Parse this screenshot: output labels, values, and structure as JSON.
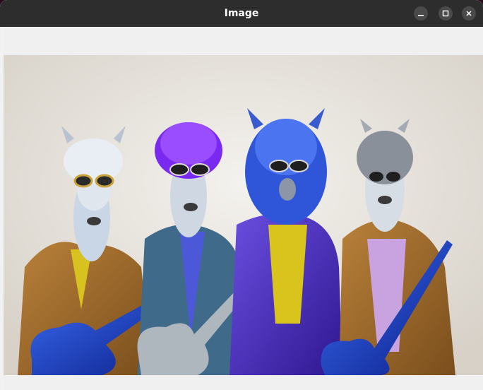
{
  "window": {
    "title": "Image"
  },
  "controls": {
    "minimize_icon": "minimize-icon",
    "maximize_icon": "maximize-icon",
    "close_icon": "close-icon"
  },
  "image": {
    "subject": "photo",
    "colors": {
      "background": "#e9e6e1",
      "titlebar": "#2d2d2d"
    }
  }
}
